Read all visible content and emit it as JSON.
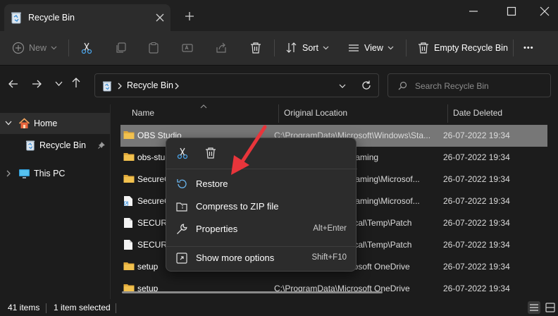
{
  "window": {
    "tab_title": "Recycle Bin",
    "new_tab_symbol": "+"
  },
  "toolbar": {
    "new_label": "New",
    "sort_label": "Sort",
    "view_label": "View",
    "empty_label": "Empty Recycle Bin",
    "more_label": "•••"
  },
  "address": {
    "location": "Recycle Bin",
    "search_placeholder": "Search Recycle Bin"
  },
  "sidebar": {
    "items": [
      {
        "label": "Home"
      },
      {
        "label": "Recycle Bin"
      },
      {
        "label": "This PC"
      }
    ]
  },
  "columns": {
    "name": "Name",
    "location": "Original Location",
    "date": "Date Deleted"
  },
  "rows": [
    {
      "name": "OBS Studio",
      "location": "C:\\ProgramData\\Microsoft\\Windows\\Sta...",
      "date": "26-07-2022 19:34",
      "icon": "folder-icon"
    },
    {
      "name": "obs-studio",
      "location": "C:\\Users\\AppData\\Roaming",
      "date": "26-07-2022 19:34",
      "icon": "folder-icon"
    },
    {
      "name": "SecureCRT",
      "location": "C:\\Users\\AppData\\Roaming\\Microsof...",
      "date": "26-07-2022 19:34",
      "icon": "folder-icon"
    },
    {
      "name": "SecureCRT",
      "location": "C:\\Users\\AppData\\Roaming\\Microsof...",
      "date": "26-07-2022 19:34",
      "icon": "shortcut-icon"
    },
    {
      "name": "SECURE",
      "location": "C:\\Users\\AppData\\Local\\Temp\\Patch",
      "date": "26-07-2022 19:34",
      "icon": "file-icon"
    },
    {
      "name": "SECURE",
      "location": "C:\\Users\\AppData\\Local\\Temp\\Patch",
      "date": "26-07-2022 19:34",
      "icon": "file-icon"
    },
    {
      "name": "setup",
      "location": "C:\\ProgramData\\Microsoft OneDrive",
      "date": "26-07-2022 19:34",
      "icon": "folder-icon"
    },
    {
      "name": "setup",
      "location": "C:\\ProgramData\\Microsoft OneDrive",
      "date": "26-07-2022 19:34",
      "icon": "folder-icon"
    }
  ],
  "context_menu": {
    "restore": "Restore",
    "compress": "Compress to ZIP file",
    "properties": "Properties",
    "properties_shortcut": "Alt+Enter",
    "more_options": "Show more options",
    "more_options_shortcut": "Shift+F10"
  },
  "status": {
    "count": "41 items",
    "selected": "1 item selected"
  },
  "colors": {
    "accent_arrow": "#e8353b",
    "folder": "#f2c14e",
    "selection": "#777777",
    "background": "#1c1c1c"
  }
}
